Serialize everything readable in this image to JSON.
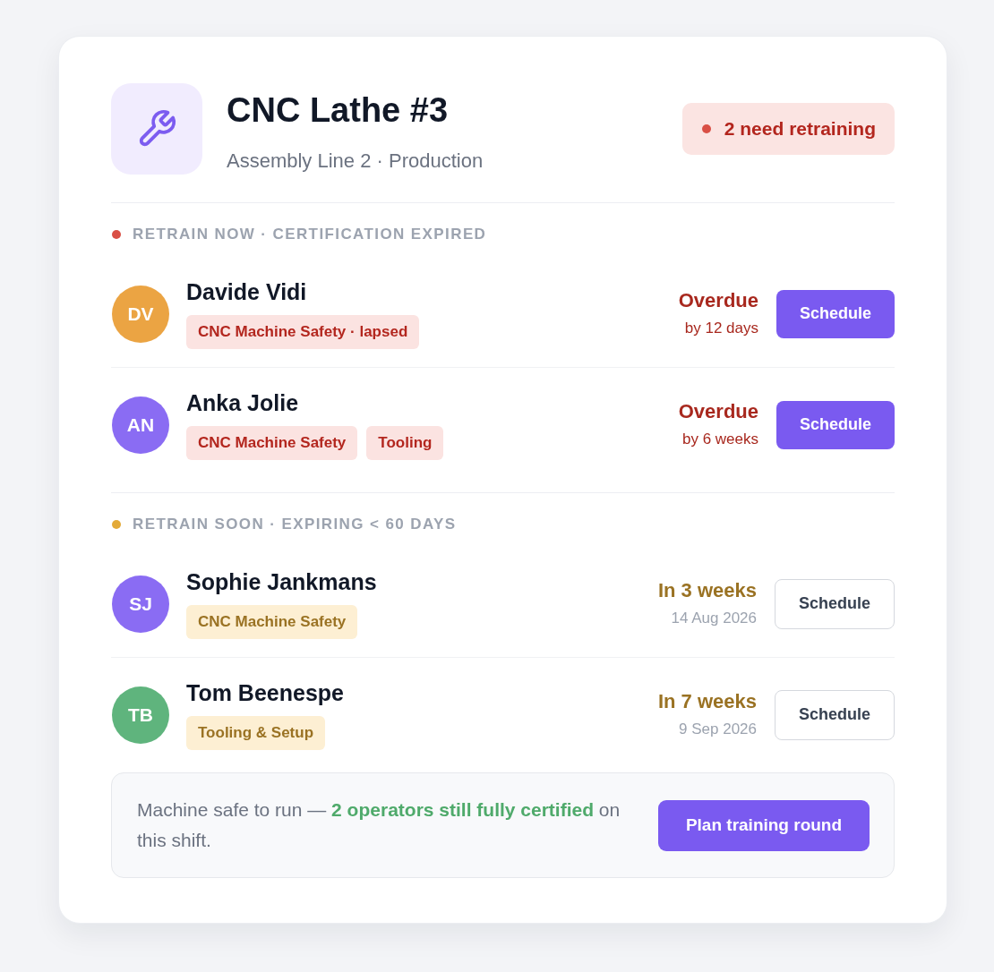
{
  "machine": {
    "title": "CNC Lathe #3",
    "subtitle": "Assembly Line 2 · Production"
  },
  "alert": {
    "label": "2 need retraining"
  },
  "sections": [
    {
      "kind": "now",
      "heading": "RETRAIN NOW · CERTIFICATION EXPIRED",
      "people": [
        {
          "initials": "DV",
          "color": "#eba443",
          "name": "Davide Vidi",
          "tags": [
            "CNC Machine Safety · lapsed"
          ],
          "status": "Overdue",
          "detail": "by 12 days",
          "action": "Schedule"
        },
        {
          "initials": "AN",
          "color": "#8a6cf3",
          "name": "Anka Jolie",
          "tags": [
            "CNC Machine Safety",
            "Tooling"
          ],
          "status": "Overdue",
          "detail": "by 6 weeks",
          "action": "Schedule"
        }
      ]
    },
    {
      "kind": "soon",
      "heading": "RETRAIN SOON · EXPIRING < 60 DAYS",
      "people": [
        {
          "initials": "SJ",
          "color": "#8a6cf3",
          "name": "Sophie Jankmans",
          "tags": [
            "CNC Machine Safety"
          ],
          "status": "In 3 weeks",
          "detail": "14 Aug 2026",
          "action": "Schedule"
        },
        {
          "initials": "TB",
          "color": "#5fb47d",
          "name": "Tom Beenespe",
          "tags": [
            "Tooling & Setup"
          ],
          "status": "In 7 weeks",
          "detail": "9 Sep 2026",
          "action": "Schedule"
        }
      ]
    }
  ],
  "footer": {
    "note": "Machine safe to run — **2 operators still fully certified** on this shift.",
    "button": "Plan training round"
  }
}
